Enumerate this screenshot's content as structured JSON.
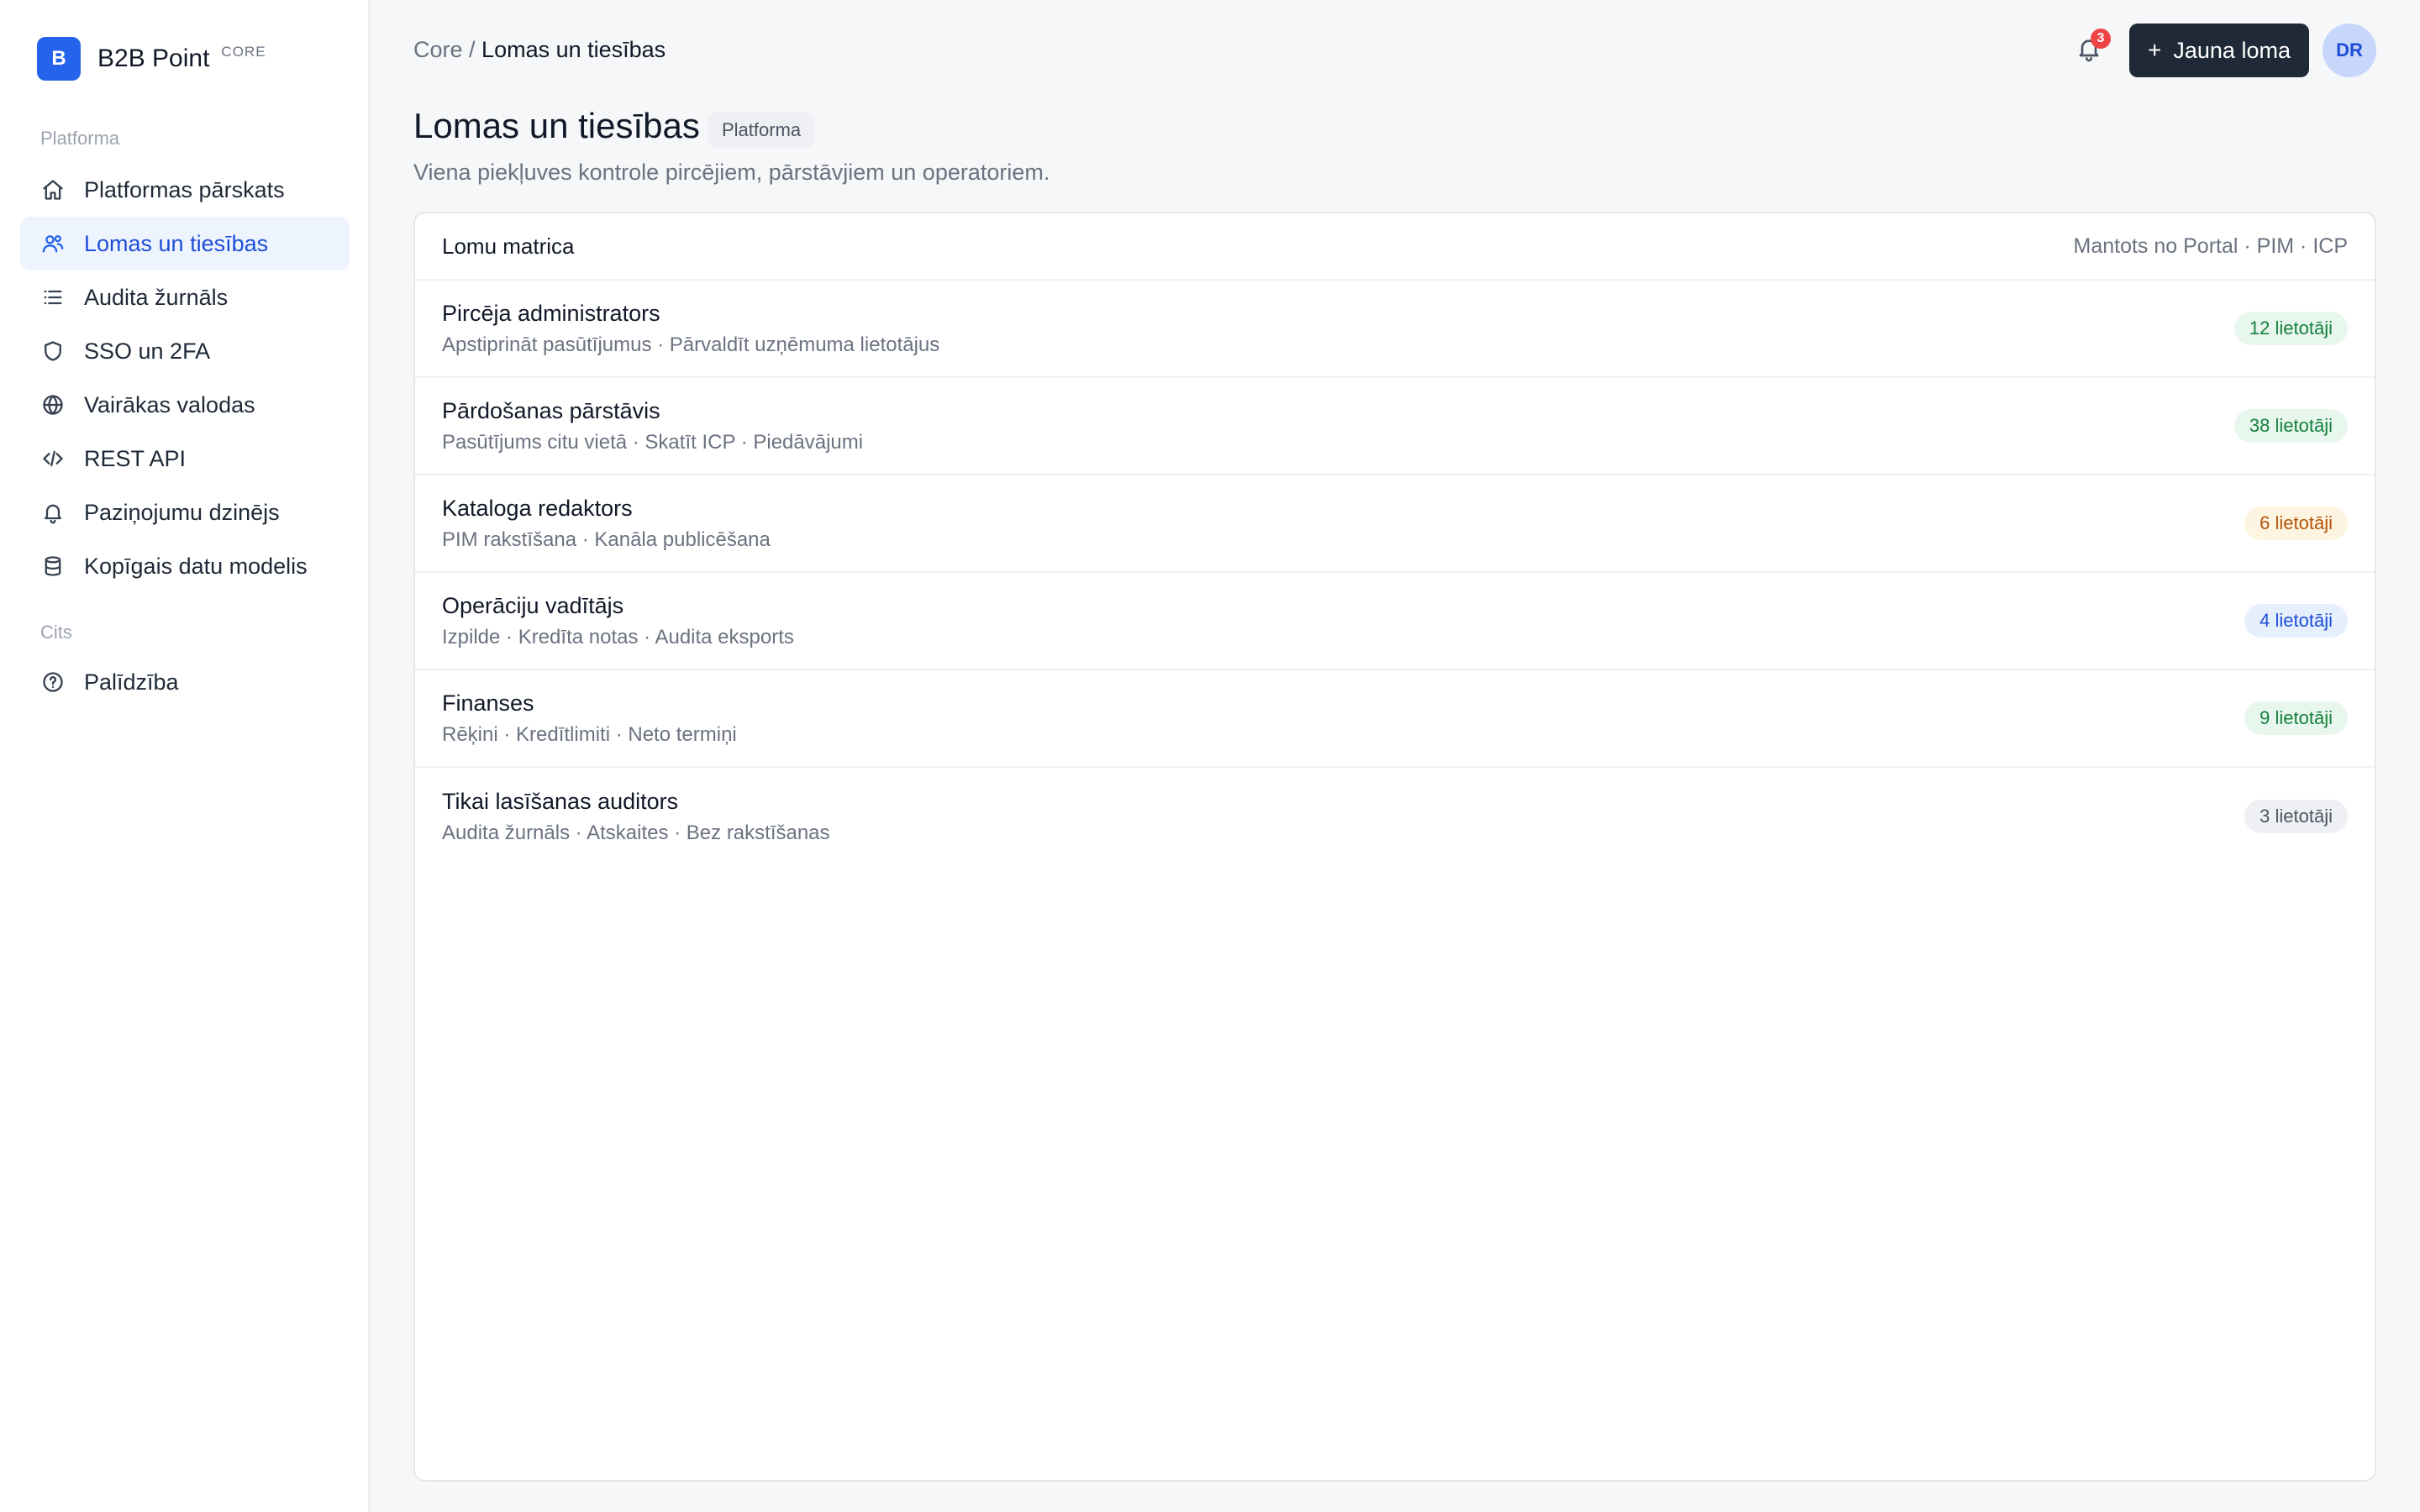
{
  "brand": {
    "logo_letter": "B",
    "name": "B2B Point",
    "tag": "CORE"
  },
  "sidebar": {
    "sections": [
      {
        "title": "Platforma"
      },
      {
        "title": "Cits"
      }
    ],
    "items": [
      {
        "label": "Platformas pārskats",
        "icon": "home-icon"
      },
      {
        "label": "Lomas un tiesības",
        "icon": "users-icon",
        "active": true
      },
      {
        "label": "Audita žurnāls",
        "icon": "list-icon"
      },
      {
        "label": "SSO un 2FA",
        "icon": "shield-icon"
      },
      {
        "label": "Vairākas valodas",
        "icon": "globe-icon"
      },
      {
        "label": "REST API",
        "icon": "code-icon"
      },
      {
        "label": "Paziņojumu dzinējs",
        "icon": "bell-icon"
      },
      {
        "label": "Kopīgais datu modelis",
        "icon": "database-icon"
      },
      {
        "label": "Palīdzība",
        "icon": "help-circle-icon"
      }
    ]
  },
  "header": {
    "breadcrumb_root": "Core",
    "breadcrumb_sep": " / ",
    "breadcrumb_current": "Lomas un tiesības",
    "notification_count": "3",
    "new_button_plus": "+",
    "new_button_label": "Jauna loma",
    "avatar_initials": "DR"
  },
  "page": {
    "title": "Lomas un tiesības",
    "chip": "Platforma",
    "subtitle": "Viena piekļuves kontrole pircējiem, pārstāvjiem un operatoriem."
  },
  "card": {
    "title": "Lomu matrica",
    "meta": "Mantots no Portal · PIM · ICP",
    "roles": [
      {
        "name": "Pircēja administrators",
        "desc": "Apstiprināt pasūtījumus · Pārvaldīt uzņēmuma lietotājus",
        "users": "12 lietotāji",
        "tone": "green"
      },
      {
        "name": "Pārdošanas pārstāvis",
        "desc": "Pasūtījums citu vietā · Skatīt ICP · Piedāvājumi",
        "users": "38 lietotāji",
        "tone": "green"
      },
      {
        "name": "Kataloga redaktors",
        "desc": "PIM rakstīšana · Kanāla publicēšana",
        "users": "6 lietotāji",
        "tone": "amber"
      },
      {
        "name": "Operāciju vadītājs",
        "desc": "Izpilde · Kredīta notas · Audita eksports",
        "users": "4 lietotāji",
        "tone": "blue"
      },
      {
        "name": "Finanses",
        "desc": "Rēķini · Kredītlimiti · Neto termiņi",
        "users": "9 lietotāji",
        "tone": "green"
      },
      {
        "name": "Tikai lasīšanas auditors",
        "desc": "Audita žurnāls · Atskaites · Bez rakstīšanas",
        "users": "3 lietotāji",
        "tone": "gray"
      }
    ]
  },
  "colors": {
    "accent": "#2563eb",
    "primary_button": "#1f2937",
    "notification": "#ef4444"
  }
}
